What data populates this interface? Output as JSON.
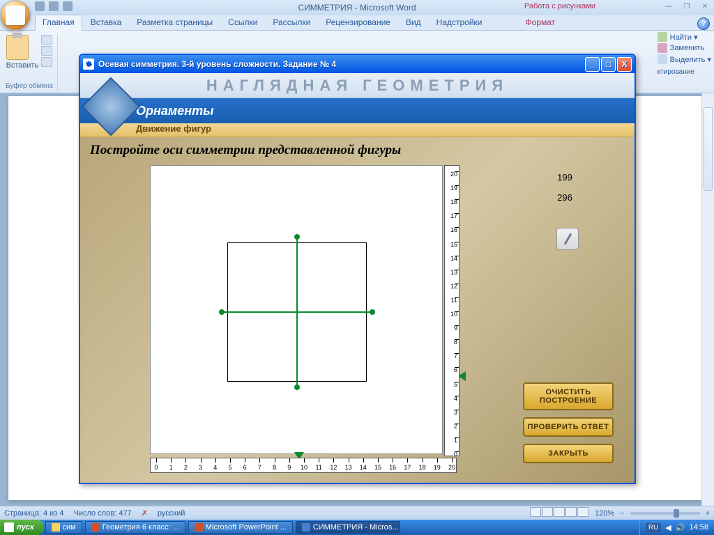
{
  "word": {
    "title": "СИММЕТРИЯ - Microsoft Word",
    "contextual_tab_title": "Работа с рисунками",
    "tabs": [
      "Главная",
      "Вставка",
      "Разметка страницы",
      "Ссылки",
      "Рассылки",
      "Рецензирование",
      "Вид",
      "Надстройки",
      "Формат"
    ],
    "paste_label": "Вставить",
    "clipboard_group": "Буфер обмена",
    "editing_group": "ктирование",
    "find": "Найти ▾",
    "replace": "Заменить",
    "select": "Выделить ▾"
  },
  "status": {
    "page": "Страница: 4 из 4",
    "words": "Число слов: 477",
    "lang": "русский",
    "zoom": "120%"
  },
  "app": {
    "title": "Осевая симметрия. 3-й уровень сложности. Задание № 4",
    "banner": "НАГЛЯДНАЯ ГЕОМЕТРИЯ",
    "section": "Орнаменты",
    "subsection": "Движение фигур",
    "prompt": "Постройте оси симметрии представленной фигуры",
    "coord1": "199",
    "coord2": "296",
    "btn_clear": "ОЧИСТИТЬ ПОСТРОЕНИЕ",
    "btn_check": "ПРОВЕРИТЬ ОТВЕТ",
    "btn_close": "ЗАКРЫТЬ",
    "ruler_max": 20
  },
  "taskbar": {
    "start": "пуск",
    "tasks": [
      "сим",
      "Геометрия 6 класс: ...",
      "Microsoft PowerPoint ...",
      "СИММЕТРИЯ - Micros..."
    ],
    "lang": "RU",
    "time": "14:58"
  }
}
